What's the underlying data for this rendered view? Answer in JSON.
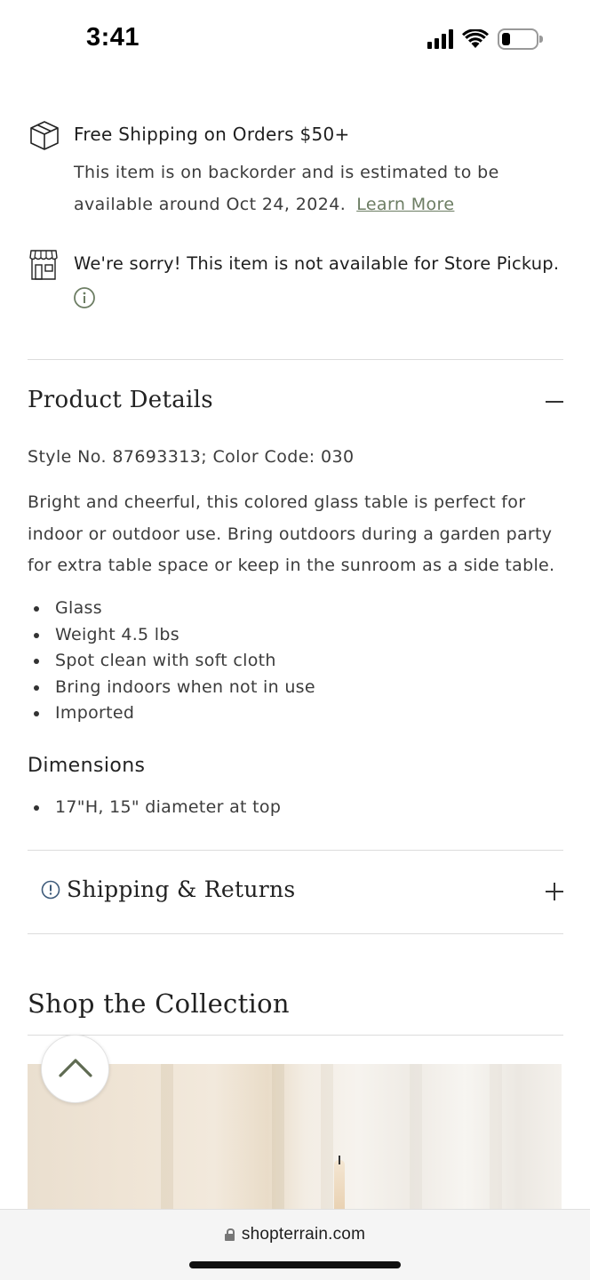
{
  "status_bar": {
    "time": "3:41",
    "icons": [
      "signal-icon",
      "wifi-icon",
      "battery-icon"
    ]
  },
  "shipping": {
    "title": "Free Shipping on Orders $50+",
    "backorder_text": "This item is on backorder and is estimated to be available around Oct 24, 2024.",
    "learn_more": "Learn More"
  },
  "pickup": {
    "text": "We're sorry! This item is not available for Store Pickup."
  },
  "product_details": {
    "title": "Product Details",
    "style_no": "Style No. 87693313; Color Code: 030",
    "description": "Bright and cheerful, this colored glass table is perfect for indoor or outdoor use. Bring outdoors during a garden party for extra table space or keep in the sunroom as a side table.",
    "features": [
      "Glass",
      "Weight 4.5 lbs",
      "Spot clean with soft cloth",
      "Bring indoors when not in use",
      "Imported"
    ],
    "dimensions_title": "Dimensions",
    "dimensions": [
      "17\"H, 15\" diameter at top"
    ]
  },
  "shipping_returns": {
    "title": "Shipping & Returns"
  },
  "collection": {
    "title": "Shop the Collection"
  },
  "browser": {
    "url": "shopterrain.com"
  },
  "colors": {
    "accent": "#6c7d63",
    "alert_blue": "#3d5a7a",
    "text": "#3c3c3c"
  }
}
